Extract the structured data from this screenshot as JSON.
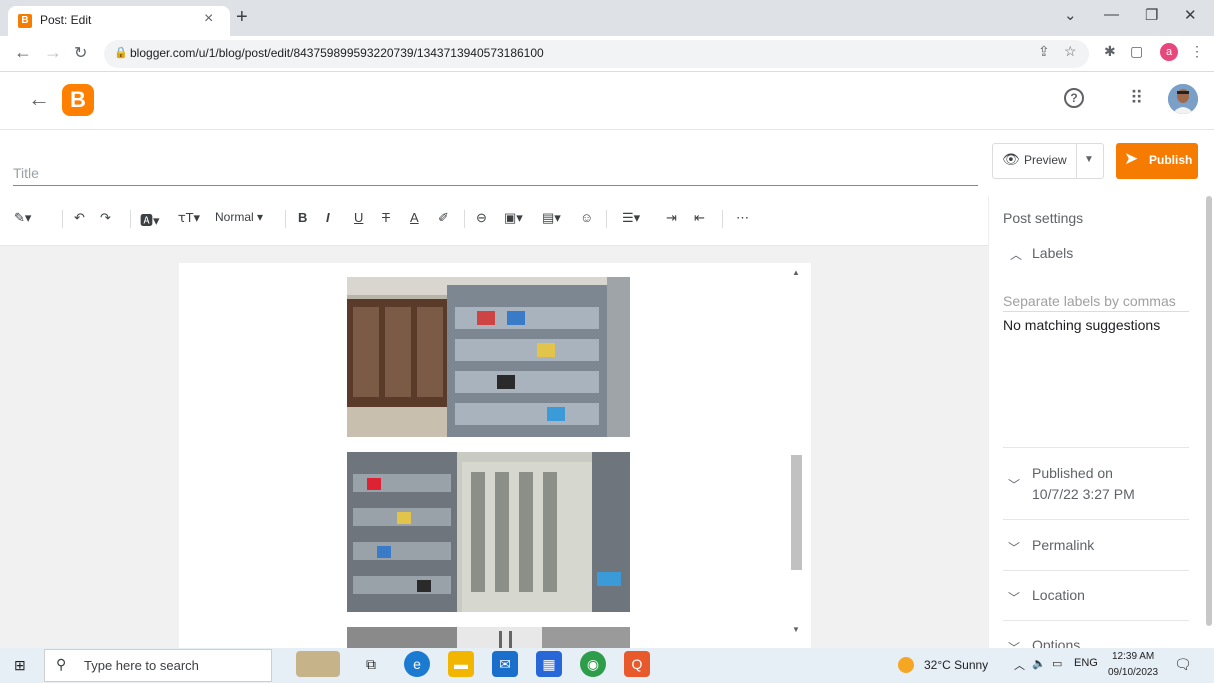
{
  "browser": {
    "tab_title": "Post: Edit",
    "tab_favicon": "B",
    "new_tab": "+",
    "close_tab": "×",
    "url": "blogger.com/u/1/blog/post/edit/843759899593220739/1343713940573186100",
    "profile_initial": "a",
    "window_controls": {
      "dropdown": "⌄",
      "minimize": "—",
      "restore": "❐",
      "close": "✕"
    }
  },
  "header": {
    "logo_letter": "B",
    "help_glyph": "?"
  },
  "post": {
    "title_placeholder": "Title",
    "preview_label": "Preview",
    "publish_label": "Publish"
  },
  "toolbar": {
    "paragraph_style": "Normal"
  },
  "settings": {
    "heading": "Post settings",
    "labels_heading": "Labels",
    "labels_placeholder": "Separate labels by commas",
    "no_match": "No matching suggestions",
    "published_on_label": "Published on",
    "published_on_value": "10/7/22 3:27 PM",
    "permalink": "Permalink",
    "location": "Location",
    "options": "Options"
  },
  "taskbar": {
    "search_placeholder": "Type here to search",
    "weather": "32°C  Sunny",
    "language": "ENG",
    "time": "12:39 AM",
    "date": "09/10/2023"
  },
  "colors": {
    "accent": "#f57c00",
    "title_underline": "#e37400"
  }
}
